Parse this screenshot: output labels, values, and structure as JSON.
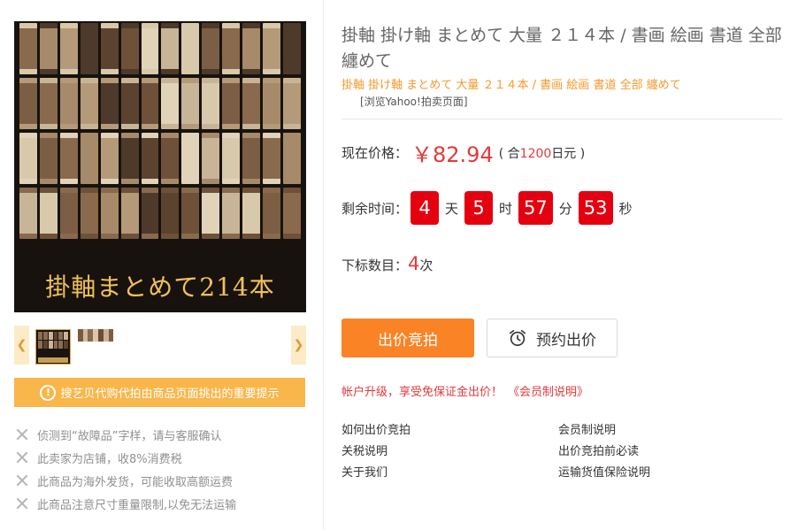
{
  "product": {
    "title": "掛軸 掛け軸 まとめて 大量 ２１４本 / 書画 絵画 書道 全部 纏めて",
    "subtitle": "掛軸 掛け軸 まとめて 大量 ２１４本 / 書画 絵画 書道 全部 纏めて",
    "browse_link": "[浏览Yahoo!拍卖页面]",
    "image_caption": "掛軸まとめて214本"
  },
  "price": {
    "label": "现在价格：",
    "value": "￥82.94",
    "sub_prefix": "( 合",
    "sub_yen": "1200",
    "sub_suffix": "日元 )"
  },
  "countdown": {
    "label": "剩余时间：",
    "days": "4",
    "days_unit": "天",
    "hours": "5",
    "hours_unit": "时",
    "minutes": "57",
    "minutes_unit": "分",
    "seconds": "53",
    "seconds_unit": "秒"
  },
  "bids": {
    "label": "下标数目：",
    "count": "4",
    "unit": "次"
  },
  "buttons": {
    "bid": "出价竞拍",
    "reserve": "预约出价"
  },
  "member_note": {
    "text": "帐户升级，享受免保证金出价！",
    "link": "《会员制说明》"
  },
  "notice": {
    "text": "搜艺贝代购代拍由商品页面挑出的重要提示"
  },
  "warnings": [
    "侦测到“故障品”字样，请与客服确认",
    "此卖家为店铺，收8%消费税",
    "此商品为海外发货，可能收取高额运费",
    "此商品注意尺寸重量限制,以免无法运输"
  ],
  "help_links": [
    "如何出价竞拍",
    "会员制说明",
    "关税说明",
    "出价竞拍前必读",
    "关于我们",
    "运输货值保险说明"
  ],
  "icons": {
    "thumb_prev": "chevron-left-icon",
    "thumb_next": "chevron-right-icon",
    "notice": "exclamation-circle-icon",
    "warning": "close-icon",
    "reserve": "alarm-clock-icon"
  },
  "colors": {
    "accent_orange": "#fa8325",
    "notice_orange": "#f8b64b",
    "price_red": "#e4393c",
    "timer_red": "#e4000f"
  }
}
